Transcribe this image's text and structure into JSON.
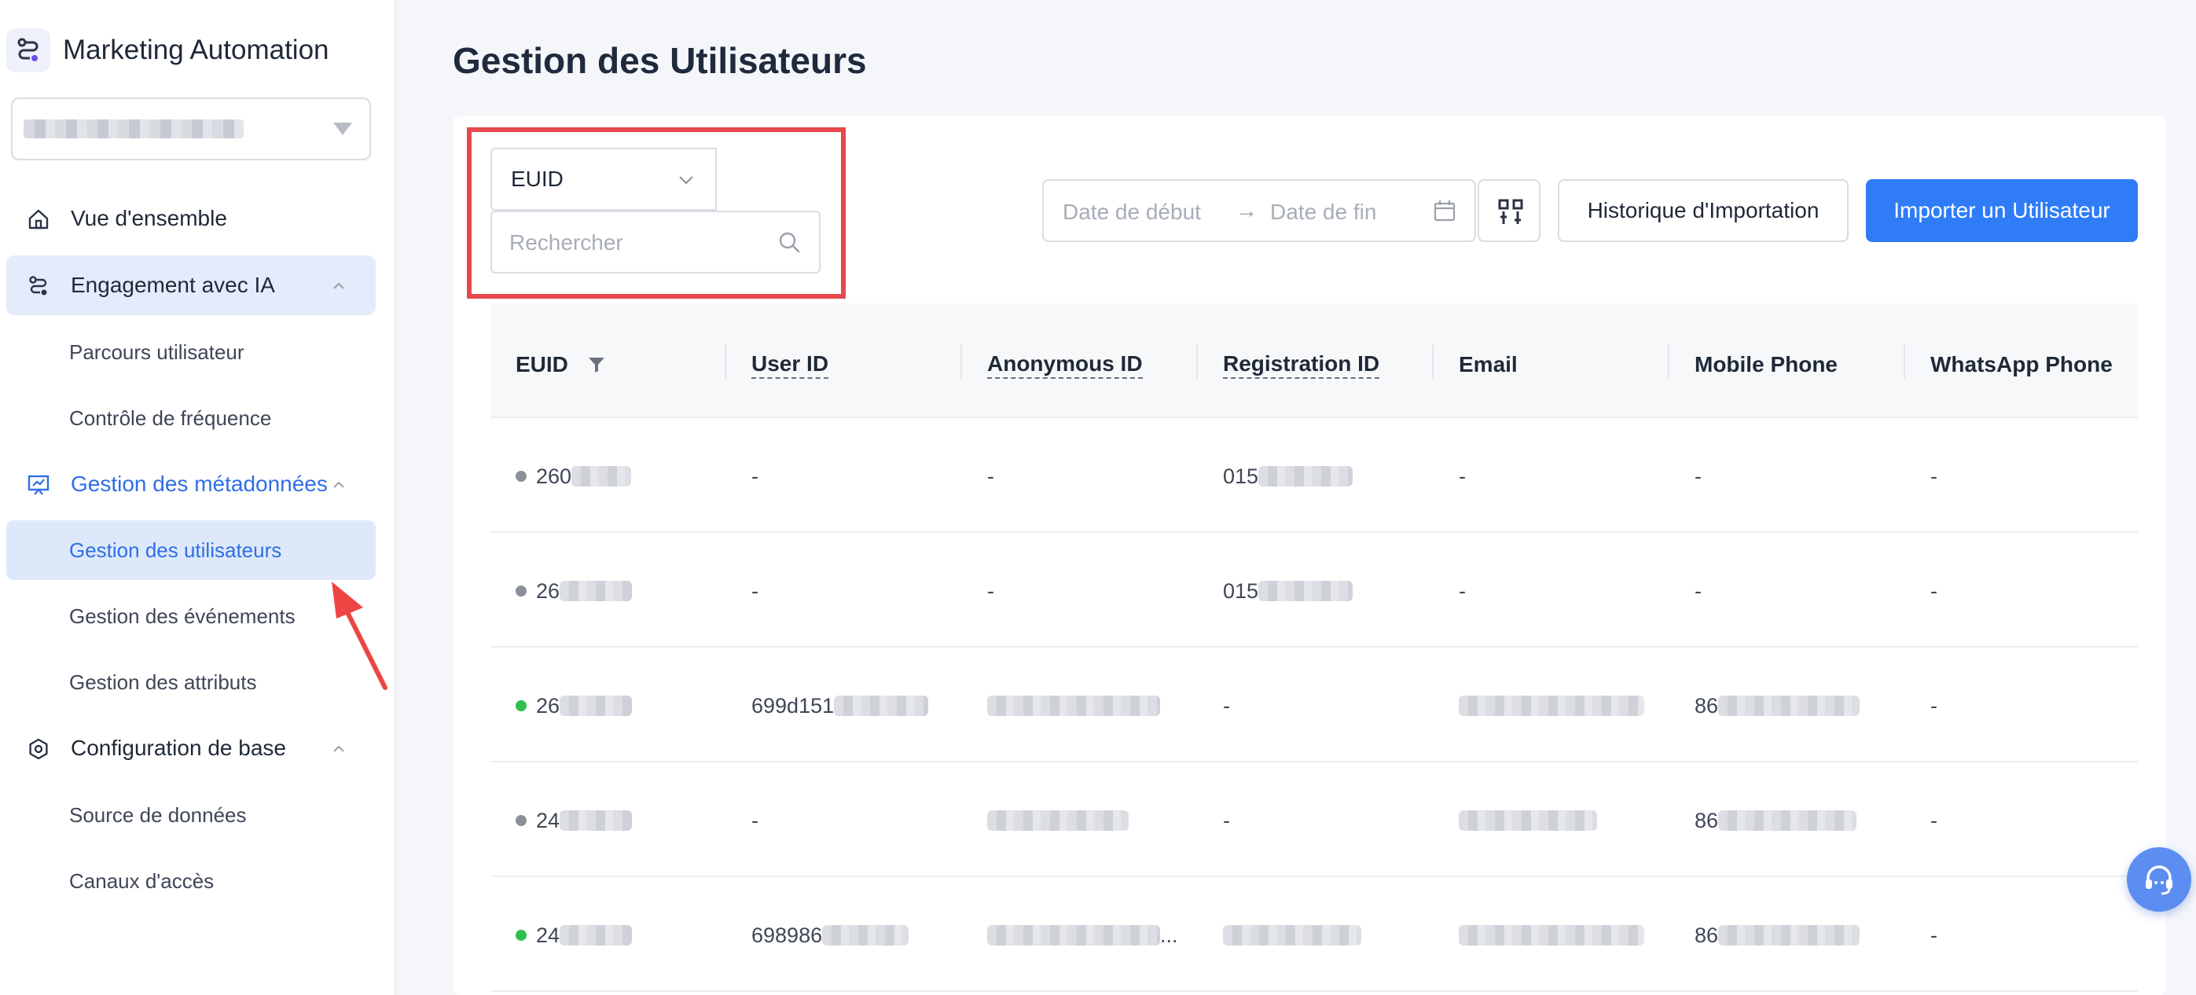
{
  "app": {
    "title": "Marketing Automation",
    "brand_color": "#2f7cf6",
    "accent_active_bg": "#dde9fb"
  },
  "sidebar": {
    "workspace_value": "",
    "groups": [
      {
        "label": "Vue d'ensemble",
        "icon": "home-icon"
      },
      {
        "label": "Engagement avec IA",
        "icon": "flow-icon",
        "expanded": true,
        "children": [
          "Parcours utilisateur",
          "Contrôle de fréquence"
        ]
      },
      {
        "label": "Gestion des métadonnées",
        "icon": "chart-board-icon",
        "expanded": true,
        "children": [
          "Gestion des utilisateurs",
          "Gestion des événements",
          "Gestion des attributs"
        ],
        "active_child": "Gestion des utilisateurs"
      },
      {
        "label": "Configuration de base",
        "icon": "hexagon-settings-icon",
        "expanded": true,
        "children": [
          "Source de données",
          "Canaux d'accès"
        ]
      }
    ]
  },
  "main": {
    "title": "Gestion des Utilisateurs",
    "filter": {
      "field_value": "EUID",
      "search_placeholder": "Rechercher"
    },
    "date_range": {
      "start_placeholder": "Date de début",
      "separator": "→",
      "end_placeholder": "Date de fin"
    },
    "buttons": {
      "history": "Historique d'Importation",
      "import": "Importer un Utilisateur"
    }
  },
  "table": {
    "columns": [
      "EUID",
      "User ID",
      "Anonymous ID",
      "Registration ID",
      "Email",
      "Mobile Phone",
      "WhatsApp Phone"
    ],
    "rows": [
      {
        "status": "grey",
        "euid": "260",
        "user_id": "-",
        "anonymous_id": "-",
        "registration_id": "015",
        "email": "-",
        "mobile_phone": "-",
        "whatsapp_phone": "-"
      },
      {
        "status": "grey",
        "euid": "26",
        "user_id": "-",
        "anonymous_id": "-",
        "registration_id": "015",
        "email": "-",
        "mobile_phone": "-",
        "whatsapp_phone": "-"
      },
      {
        "status": "green",
        "euid": "26",
        "user_id": "699d151",
        "anonymous_id": "",
        "registration_id": "-",
        "email": "",
        "mobile_phone": "86",
        "whatsapp_phone": "-"
      },
      {
        "status": "grey",
        "euid": "24",
        "user_id": "-",
        "anonymous_id": "",
        "registration_id": "-",
        "email": "",
        "mobile_phone": "86",
        "whatsapp_phone": "-"
      },
      {
        "status": "green",
        "euid": "24",
        "user_id": "698986",
        "anonymous_id": "...",
        "registration_id": "",
        "email": "",
        "mobile_phone": "86",
        "whatsapp_phone": "-"
      }
    ],
    "status_colors": {
      "grey": "#8a8f99",
      "green": "#2fbf4f"
    }
  }
}
